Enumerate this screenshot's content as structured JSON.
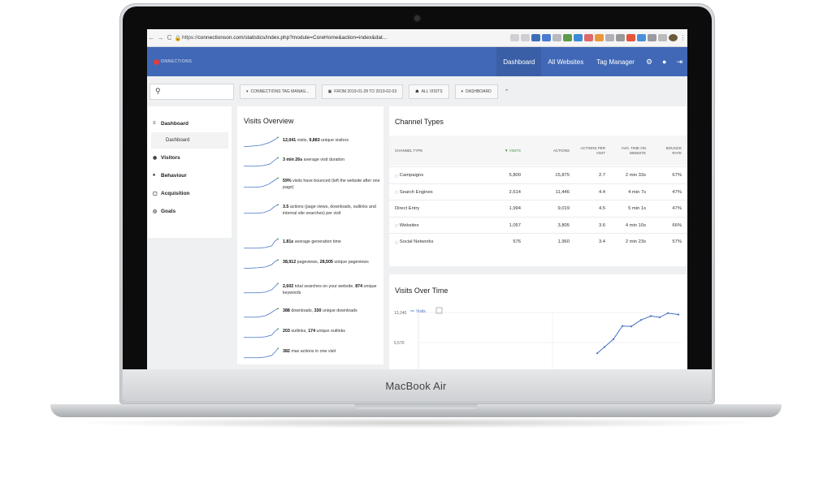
{
  "device": {
    "brand": "MacBook Air"
  },
  "browser": {
    "back": "←",
    "forward": "→",
    "reload": "C",
    "url_prefix": "https://",
    "url_rest": "connectionson.com/statistics/index.php?module=CoreHome&action=index&dat..."
  },
  "appbar": {
    "logo_text": "ONNECTIONS",
    "nav": [
      "Dashboard",
      "All Websites",
      "Tag Manager"
    ],
    "active_nav": "Dashboard"
  },
  "filters": {
    "container": "CONNECTIONS TAG MANAG...",
    "date_range": "FROM 2019-01-28 TO 2019-02-03",
    "segment": "ALL VISITS",
    "dashboard": "DASHBOARD"
  },
  "sidebar": {
    "items": [
      {
        "label": "Dashboard",
        "icon": "grid-icon"
      },
      {
        "label": "Visitors",
        "icon": "eye-icon"
      },
      {
        "label": "Behaviour",
        "icon": "bell-icon"
      },
      {
        "label": "Acquisition",
        "icon": "box-icon"
      },
      {
        "label": "Goals",
        "icon": "target-icon"
      }
    ],
    "sub_item": "Dashboard"
  },
  "visits_overview": {
    "title": "Visits Overview",
    "rows": [
      {
        "b1": "12,041",
        "t1": " visits, ",
        "b2": "9,883",
        "t2": " unique visitors"
      },
      {
        "b1": "3 min 26s",
        "t1": " average visit duration",
        "b2": "",
        "t2": ""
      },
      {
        "b1": "59%",
        "t1": " visits have bounced (left the website after one page)",
        "b2": "",
        "t2": ""
      },
      {
        "b1": "3.5",
        "t1": " actions (page views, downloads, outlinks and internal site searches) per visit",
        "b2": "",
        "t2": ""
      },
      {
        "b1": "1.81s",
        "t1": " average generation time",
        "b2": "",
        "t2": ""
      },
      {
        "b1": "38,912",
        "t1": " pageviews, ",
        "b2": "28,505",
        "t2": " unique pageviews"
      },
      {
        "b1": "2,602",
        "t1": " total searches on your website, ",
        "b2": "874",
        "t2": " unique keywords"
      },
      {
        "b1": "388",
        "t1": " downloads, ",
        "b2": "330",
        "t2": " unique downloads"
      },
      {
        "b1": "203",
        "t1": " outlinks, ",
        "b2": "174",
        "t2": " unique outlinks"
      },
      {
        "b1": "382",
        "t1": " max actions in one visit",
        "b2": "",
        "t2": ""
      }
    ]
  },
  "channel_types": {
    "title": "Channel Types",
    "columns": [
      "CHANNEL TYPE",
      "▼ VISITS",
      "ACTIONS",
      "ACTIONS PER VISIT",
      "AVG. TIME ON WEBSITE",
      "BOUNCE RATE"
    ],
    "rows": [
      [
        "Campaigns",
        "5,800",
        "15,875",
        "2.7",
        "2 min 33s",
        "67%"
      ],
      [
        "Search Engines",
        "2,614",
        "11,446",
        "4.4",
        "4 min 7s",
        "47%"
      ],
      [
        "Direct Entry",
        "1,994",
        "9,019",
        "4.5",
        "5 min 1s",
        "47%"
      ],
      [
        "Websites",
        "1,057",
        "3,805",
        "3.6",
        "4 min 10s",
        "66%"
      ],
      [
        "Social Networks",
        "576",
        "1,960",
        "3.4",
        "2 min 23s",
        "57%"
      ]
    ]
  },
  "visits_over_time": {
    "title": "Visits Over Time"
  },
  "chart_data": {
    "type": "line",
    "title": "Visits Over Time",
    "series": [
      {
        "name": "Visits",
        "values": [
          4200,
          5600,
          7300,
          10200,
          10100,
          11500,
          12350,
          12100,
          13000,
          12700
        ]
      }
    ],
    "yticks": [
      "13,140",
      "6,570"
    ],
    "ylim": [
      0,
      13140
    ],
    "legend": "top-left",
    "grid": true
  },
  "colors": {
    "appbar": "#4068b6",
    "active_nav": "#3a5fa6",
    "line": "#4472c4"
  }
}
